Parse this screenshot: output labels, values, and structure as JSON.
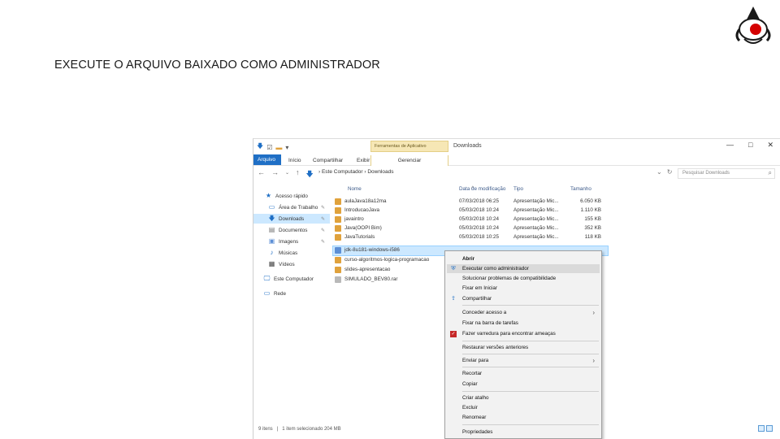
{
  "slide": {
    "title": "EXECUTE O ARQUIVO BAIXADO COMO ADMINISTRADOR"
  },
  "explorer": {
    "contextual_tab_group": "Ferramentas de Aplicativo",
    "window_title": "Downloads",
    "window_controls": {
      "minimize": "—",
      "maximize": "□",
      "close": "✕"
    },
    "ribbon_tabs": {
      "file": "Arquivo",
      "home": "Início",
      "share": "Compartilhar",
      "view": "Exibir",
      "manage": "Gerenciar"
    },
    "address": {
      "path": "›  Este Computador  ›  Downloads",
      "refresh": "↻",
      "dropdown": "⌄"
    },
    "search": {
      "placeholder": "Pesquisar Downloads"
    },
    "nav": {
      "quick_access": "Acesso rápido",
      "desktop": "Área de Trabalho",
      "downloads": "Downloads",
      "documents": "Documentos",
      "images": "Imagens",
      "music": "Músicas",
      "videos": "Vídeos",
      "this_pc": "Este Computador",
      "network": "Rede"
    },
    "columns": {
      "name": "Nome",
      "date": "Data de modificação",
      "type": "Tipo",
      "size": "Tamanho"
    },
    "files": [
      {
        "name": "aulaJava18a12ma",
        "date": "07/03/2018 06:25",
        "type": "Apresentação Mic...",
        "size": "6.050 KB"
      },
      {
        "name": "IntroducaoJava",
        "date": "05/03/2018 10:24",
        "type": "Apresentação Mic...",
        "size": "1.110 KB"
      },
      {
        "name": "javaintro",
        "date": "05/03/2018 10:24",
        "type": "Apresentação Mic...",
        "size": "155 KB"
      },
      {
        "name": "Java(OOPI Bim)",
        "date": "05/03/2018 10:24",
        "type": "Apresentação Mic...",
        "size": "352 KB"
      },
      {
        "name": "JavaTutorials",
        "date": "05/03/2018 10:25",
        "type": "Apresentação Mic...",
        "size": "118 KB"
      },
      {
        "name": "jdk-8u181-windows-i586",
        "date": "",
        "type": "",
        "size": ""
      },
      {
        "name": "curso-algoritmos-logica-programacao",
        "date": "",
        "type": "",
        "size": ""
      },
      {
        "name": "slides-apresentacao",
        "date": "",
        "type": "",
        "size": ""
      },
      {
        "name": "SIMULADO_BEV80.rar",
        "date": "",
        "type": "",
        "size": ""
      }
    ],
    "status": {
      "items": "9 itens",
      "selected": "1 item selecionado  204 MB"
    }
  },
  "context_menu": {
    "open": "Abrir",
    "run_as_admin": "Executar como administrador",
    "troubleshoot": "Solucionar problemas de compatibilidade",
    "pin_start": "Fixar em Iniciar",
    "share": "Compartilhar",
    "share_with": "Conceder acesso a",
    "pin_taskbar": "Fixar na barra de tarefas",
    "scan": "Fazer varredura para encontrar ameaças",
    "restore": "Restaurar versões anteriores",
    "send_to": "Enviar para",
    "cut": "Recortar",
    "copy": "Copiar",
    "shortcut": "Criar atalho",
    "delete": "Excluir",
    "rename": "Renomear",
    "properties": "Propriedades"
  },
  "colors": {
    "accent": "#1f6fc5",
    "selection": "#cce8ff",
    "contextual_tab": "#f6e7b5",
    "menu_bg": "#f2f2f2"
  },
  "icons": [
    "java-duke-mascot",
    "folder-icon",
    "shield-uac-icon",
    "share-icon",
    "defender-icon",
    "back-arrow-icon",
    "forward-arrow-icon",
    "up-arrow-icon",
    "search-icon"
  ]
}
